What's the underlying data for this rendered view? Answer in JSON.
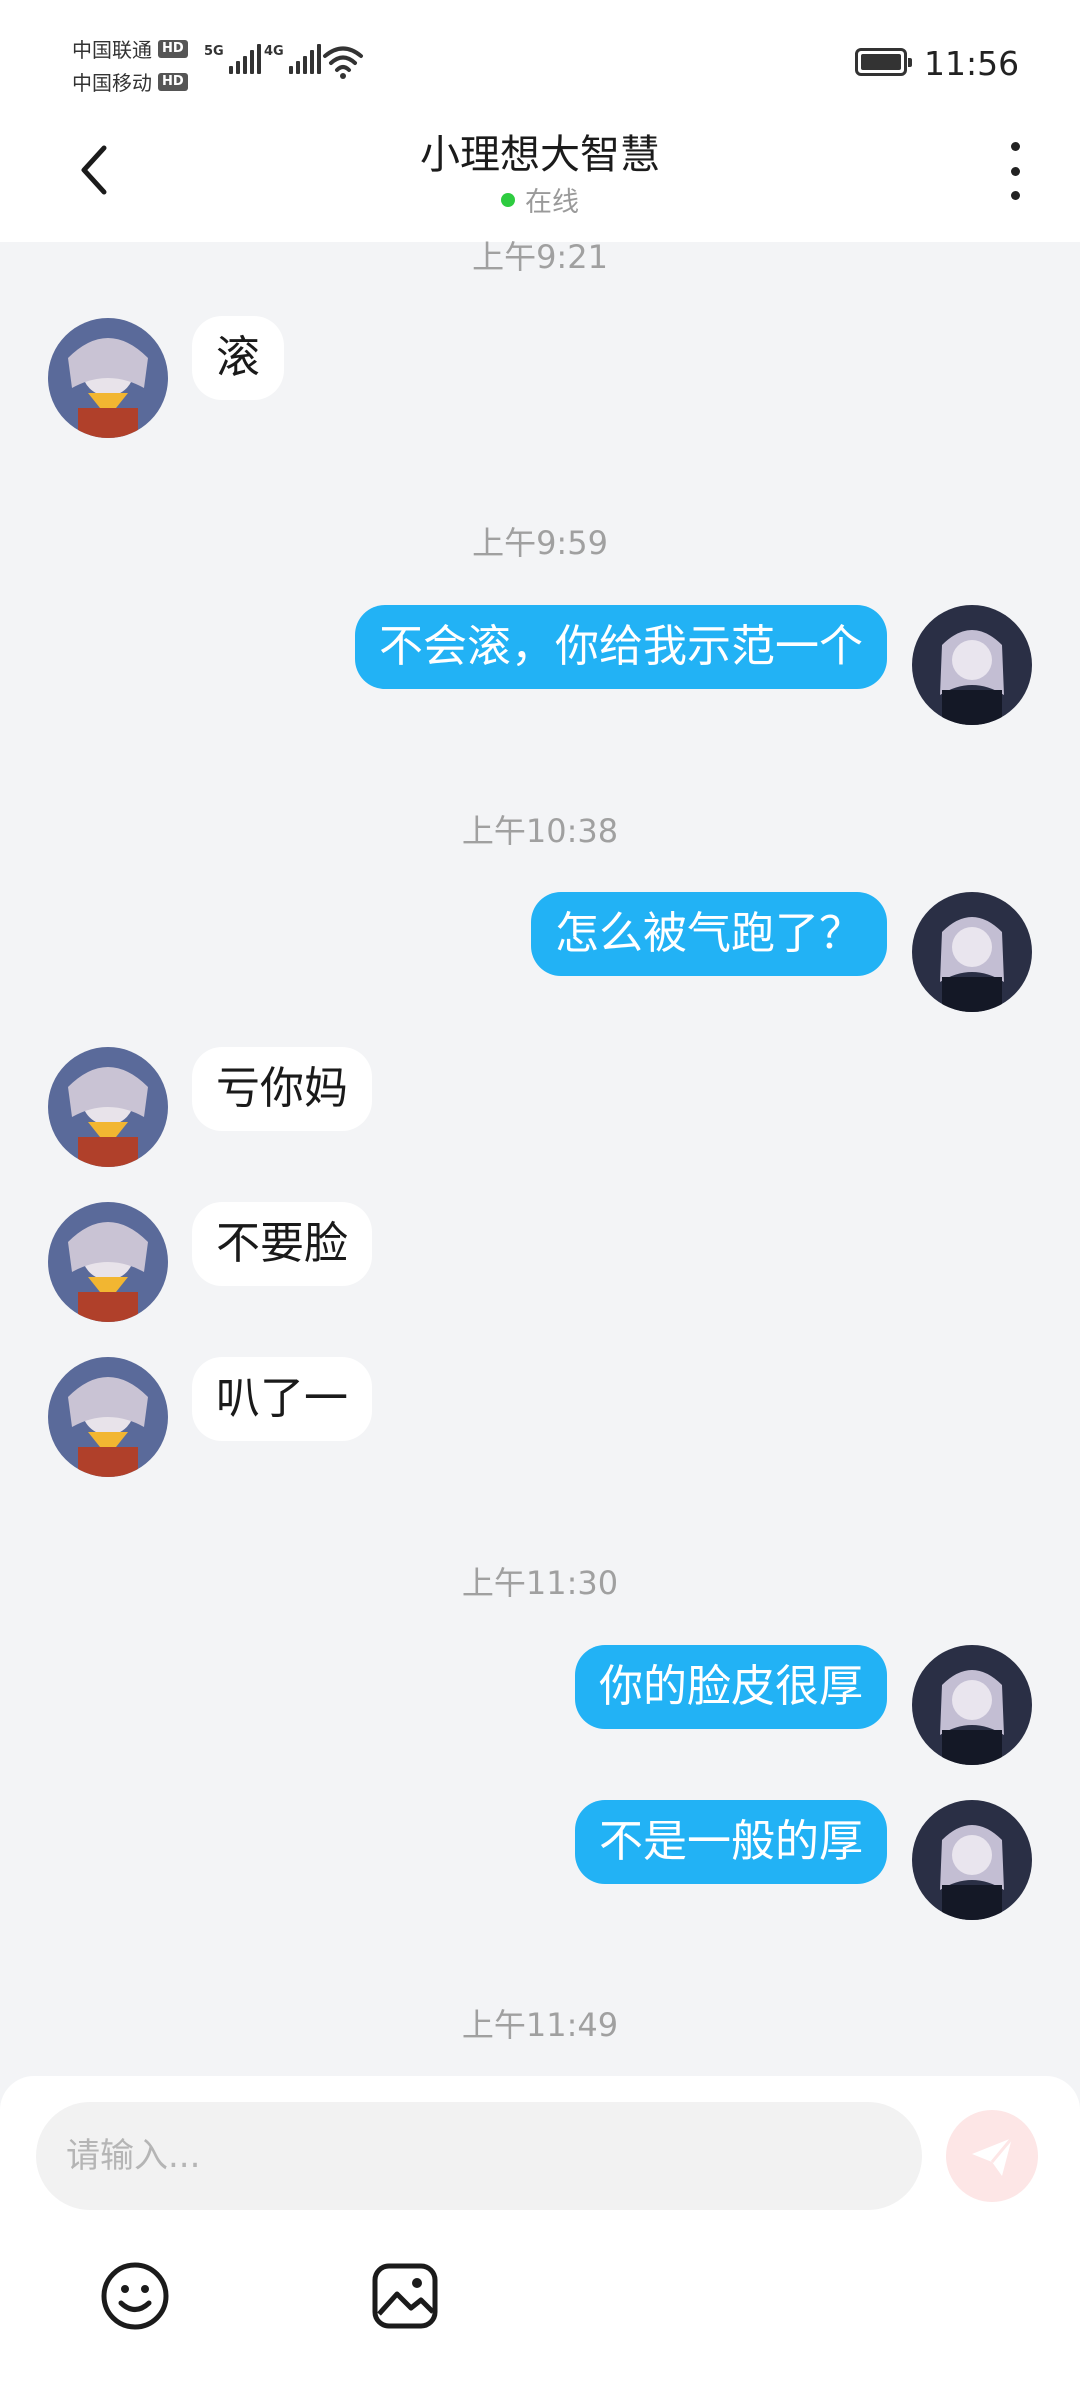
{
  "status_bar": {
    "carrier1": "中国联通",
    "carrier2": "中国移动",
    "hd_badge": "HD",
    "net1": "5G",
    "net2": "4G",
    "time": "11:56"
  },
  "header": {
    "title": "小理想大智慧",
    "status": "在线"
  },
  "messages": {
    "ts0": "上午9:21",
    "m0": "滚",
    "ts1": "上午9:59",
    "m1": "不会滚，你给我示范一个",
    "ts2": "上午10:38",
    "m2": "怎么被气跑了？",
    "m3": "亏你妈",
    "m4": "不要脸",
    "m5": "叭了一",
    "ts3": "上午11:30",
    "m6": "你的脸皮很厚",
    "m7": "不是一般的厚",
    "ts4": "上午11:49"
  },
  "input": {
    "placeholder": "请输入..."
  },
  "colors": {
    "outgoing_bubble": "#22b2f5",
    "incoming_bubble": "#ffffff",
    "online_dot": "#2ecc40",
    "send_button_bg": "#fde6e6",
    "send_icon": "#ffffff"
  },
  "icons": {
    "back": "chevron-left-icon",
    "menu": "more-vertical-icon",
    "send": "paper-plane-icon",
    "emoji": "smiley-icon",
    "image": "image-icon"
  }
}
